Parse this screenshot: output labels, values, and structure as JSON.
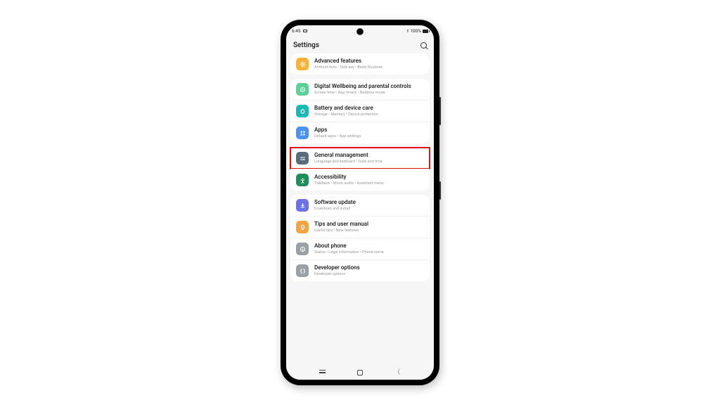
{
  "statusbar": {
    "time": "6:45",
    "battery_pct": "100%"
  },
  "appbar": {
    "title": "Settings"
  },
  "groups": [
    {
      "items": [
        {
          "key": "advanced",
          "title": "Advanced features",
          "sub": "Android Auto • Side key • Bixby Routines",
          "icon_bg": "#f9b138",
          "icon_name": "gear-icon"
        }
      ]
    },
    {
      "items": [
        {
          "key": "wellbeing",
          "title": "Digital Wellbeing and parental controls",
          "sub": "Screen time • App timers • Bedtime mode",
          "icon_bg": "#5fcf9a",
          "icon_name": "wellbeing-icon"
        },
        {
          "key": "battery",
          "title": "Battery and device care",
          "sub": "Storage • Memory • Device protection",
          "icon_bg": "#19b9b4",
          "icon_name": "care-icon"
        },
        {
          "key": "apps",
          "title": "Apps",
          "sub": "Default apps • App settings",
          "icon_bg": "#4c92f2",
          "icon_name": "grid-icon"
        }
      ]
    },
    {
      "items": [
        {
          "key": "general",
          "title": "General management",
          "sub": "Language and keyboard • Date and time",
          "icon_bg": "#5a6b7a",
          "icon_name": "sliders-icon",
          "highlight": true
        },
        {
          "key": "a11y",
          "title": "Accessibility",
          "sub": "TalkBack • Mono audio • Assistant menu",
          "icon_bg": "#1f8e5a",
          "icon_name": "accessibility-icon"
        }
      ]
    },
    {
      "items": [
        {
          "key": "update",
          "title": "Software update",
          "sub": "Download and install",
          "icon_bg": "#6d72e6",
          "icon_name": "download-icon"
        },
        {
          "key": "tips",
          "title": "Tips and user manual",
          "sub": "Useful tips • New features",
          "icon_bg": "#f2a544",
          "icon_name": "lightbulb-icon"
        },
        {
          "key": "about",
          "title": "About phone",
          "sub": "Status • Legal information • Phone name",
          "icon_bg": "#9aa0a6",
          "icon_name": "info-icon"
        },
        {
          "key": "dev",
          "title": "Developer options",
          "sub": "Developer options",
          "icon_bg": "#9aa0a6",
          "icon_name": "braces-icon"
        }
      ]
    }
  ]
}
